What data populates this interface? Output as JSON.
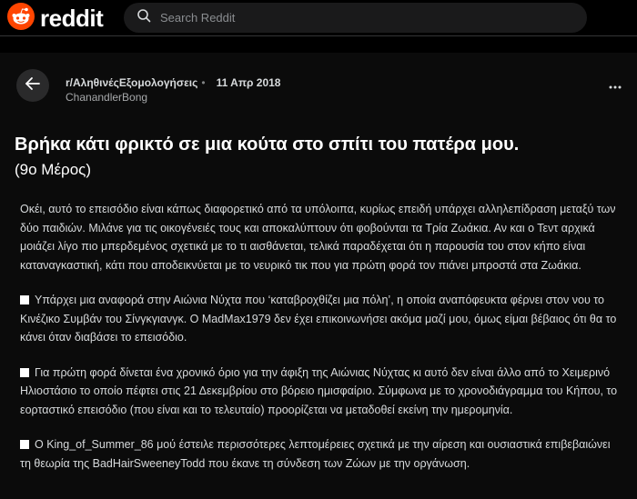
{
  "header": {
    "logo_text": "reddit",
    "search_placeholder": "Search Reddit",
    "colors": {
      "brand": "#ff4500",
      "background": "#000000"
    }
  },
  "post": {
    "subreddit": "r/ΑληθινέςΕξομολογήσεις",
    "date": "11 Απρ 2018",
    "author": "ChanandlerBong",
    "title": "Βρήκα κάτι φρικτό σε μια κούτα στο σπίτι του πατέρα μου.",
    "title_part": "(9ο Μέρος)",
    "paragraphs": [
      "Οκέι, αυτό το επεισόδιο είναι κάπως διαφορετικό από τα υπόλοιπα, κυρίως επειδή υπάρχει αλληλεπίδραση μεταξύ των δύο παιδιών. Μιλάνε για τις οικογένειές τους και  αποκαλύπτουν ότι φοβούνται τα Τρία Ζωάκια. Αν και ο Τεντ αρχικά μοιάζει λίγο πιο μπερδεμένος σχετικά με το τι αισθάνεται, τελικά παραδέχεται ότι η παρουσία του στον κήπο είναι καταναγκαστική, κάτι που αποδεικνύεται με το νευρικό τικ που για πρώτη φορά τον πιάνει μπροστά στα Ζωάκια.",
      "Υπάρχει μια αναφορά στην Αιώνια Νύχτα που ‘καταβροχθίζει μια πόλη’, η οποία αναπόφευκτα φέρνει στον νου το Κινέζικο Συμβάν του Σίνγκγιανγκ. Ο MadMax1979 δεν έχει επικοινωνήσει ακόμα μαζί μου, όμως είμαι βέβαιος ότι θα το κάνει όταν διαβάσει το επεισόδιο.",
      "Για πρώτη φορά δίνεται ένα χρονικό όριο για την άφιξη της Αιώνιας Νύχτας κι αυτό δεν είναι άλλο από το Χειμερινό Ηλιοστάσιο το οποίο πέφτει στις 21 Δεκεμβρίου στο βόρειο ημισφαίριο. Σύμφωνα με το χρονοδιάγραμμα του Κήπου, το εορταστικό επεισόδιο (που είναι και το τελευταίο) προορίζεται να μεταδοθεί εκείνη την ημερομηνία.",
      "Ο King_of_Summer_86 μού έστειλε περισσότερες λεπτομέρειες σχετικά με την αίρεση και ουσιαστικά επιβεβαιώνει τη θεωρία της  BadHairSweeneyTodd που έκανε τη σύνδεση των Ζώων με την οργάνωση."
    ]
  },
  "icons": {
    "logo": "reddit-snoo-icon",
    "search": "search-icon",
    "back": "back-arrow-icon",
    "more": "more-options-icon",
    "bullet": "white-square-icon"
  }
}
